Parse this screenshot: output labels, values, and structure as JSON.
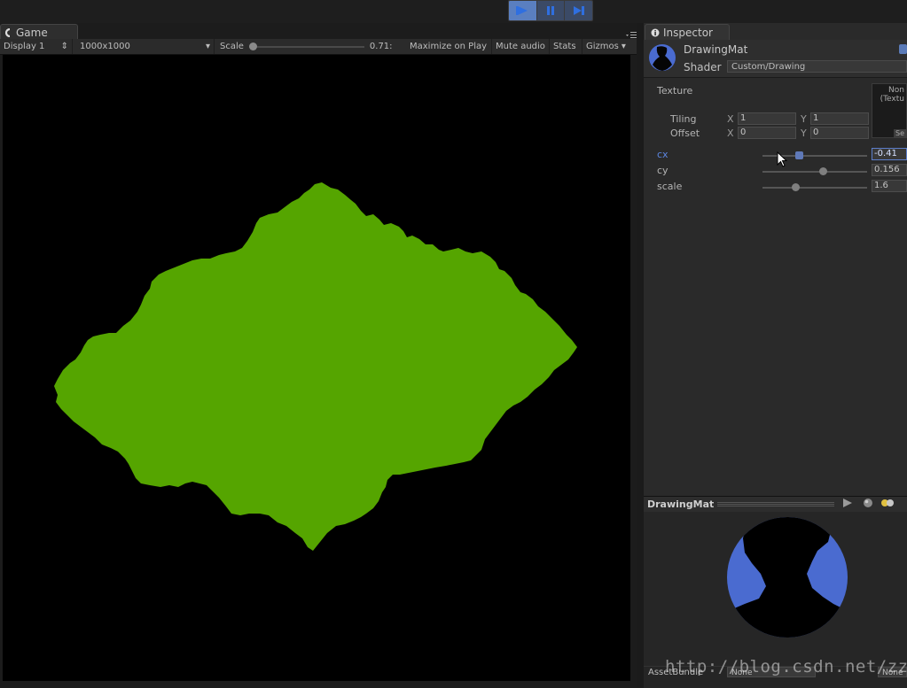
{
  "play_controls": {
    "play_icon": "play-icon",
    "pause_icon": "pause-icon",
    "step_icon": "step-icon",
    "active_color": "#5a7fc0"
  },
  "game": {
    "tab_label": "Game",
    "display": "Display 1",
    "resolution": "1000x1000",
    "scale_label": "Scale",
    "scale_value": "0.71:",
    "scale_fraction": 0.0,
    "maximize_label": "Maximize on Play",
    "mute_label": "Mute audio",
    "stats_label": "Stats",
    "gizmos_label": "Gizmos",
    "fractal_color": "#55a500",
    "background_color": "#000000"
  },
  "inspector": {
    "tab_label": "Inspector",
    "material_name": "DrawingMat",
    "shader_label": "Shader",
    "shader_value": "Custom/Drawing",
    "texture_label": "Texture",
    "texture_slot_text": "Non\n(Textu",
    "select_label": "Se",
    "tiling_label": "Tiling",
    "tiling_x": "1",
    "tiling_y": "1",
    "offset_label": "Offset",
    "offset_x": "0",
    "offset_y": "0",
    "x_axis": "X",
    "y_axis": "Y",
    "properties": [
      {
        "label": "cx",
        "value": "-0.41",
        "fraction": 0.35,
        "active": true
      },
      {
        "label": "cy",
        "value": "0.156",
        "fraction": 0.58,
        "active": false
      },
      {
        "label": "scale",
        "value": "1.6",
        "fraction": 0.31,
        "active": false
      }
    ]
  },
  "preview": {
    "title": "DrawingMat",
    "sphere_color": "#4a6bd0"
  },
  "assetbundle": {
    "label": "AssetBundle",
    "value1": "None",
    "value2": "None"
  },
  "watermark": "http://blog.csdn.net/zzlyw"
}
